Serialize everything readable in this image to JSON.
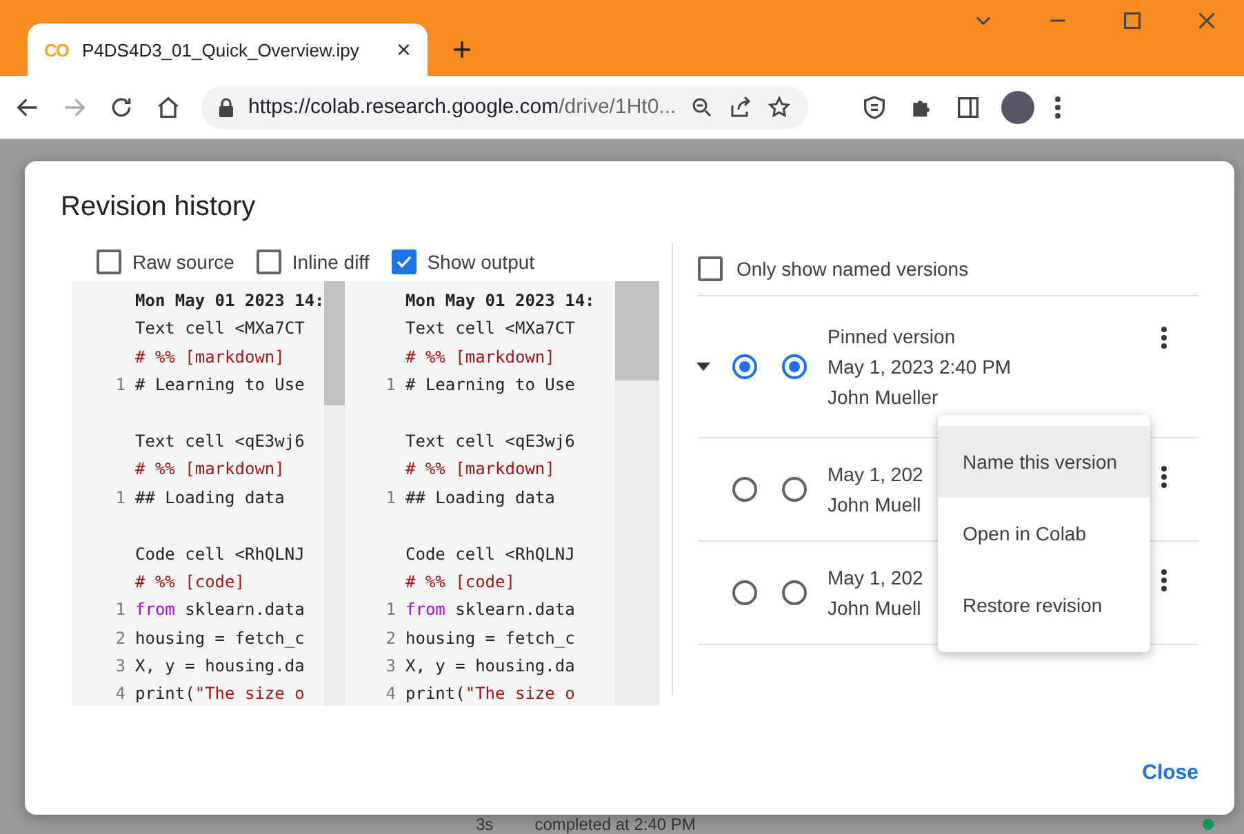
{
  "browser": {
    "tab": {
      "title": "P4DS4D3_01_Quick_Overview.ipy",
      "logo": "CO",
      "close": "×"
    },
    "new_tab": "+",
    "url": {
      "host": "https://colab.research.google.com",
      "path": "/drive/1Ht0..."
    }
  },
  "dialog": {
    "title": "Revision history",
    "options": [
      {
        "label": "Raw source",
        "checked": false
      },
      {
        "label": "Inline diff",
        "checked": false
      },
      {
        "label": "Show output",
        "checked": true
      }
    ],
    "panes": [
      {
        "lines": [
          {
            "kind": "header",
            "text": "Mon May 01 2023 14:"
          },
          {
            "kind": "plain",
            "text": "Text cell <MXa7CT"
          },
          {
            "kind": "marker",
            "text": "# %% [markdown]"
          },
          {
            "num": "1",
            "kind": "plain",
            "text": "# Learning to Use"
          },
          {
            "kind": "blank"
          },
          {
            "kind": "plain",
            "text": "Text cell <qE3wj6"
          },
          {
            "kind": "marker",
            "text": "# %% [markdown]"
          },
          {
            "num": "1",
            "kind": "plain",
            "text": "## Loading data"
          },
          {
            "kind": "blank"
          },
          {
            "kind": "plain",
            "text": "Code cell <RhQLNJ"
          },
          {
            "kind": "marker",
            "text": "# %% [code]"
          },
          {
            "num": "1",
            "kind": "keyword",
            "keyword": "from",
            "text": " sklearn.data"
          },
          {
            "num": "2",
            "kind": "plain",
            "text": "housing = fetch_c"
          },
          {
            "num": "3",
            "kind": "plain",
            "text": "X, y = housing.da"
          },
          {
            "num": "4",
            "kind": "string",
            "keyword": "print(",
            "text": "\"The size o"
          }
        ]
      },
      {
        "lines": [
          {
            "kind": "header",
            "text": "Mon May 01 2023 14:"
          },
          {
            "kind": "plain",
            "text": "Text cell <MXa7CT"
          },
          {
            "kind": "marker",
            "text": "# %% [markdown]"
          },
          {
            "num": "1",
            "kind": "plain",
            "text": "# Learning to Use"
          },
          {
            "kind": "blank"
          },
          {
            "kind": "plain",
            "text": "Text cell <qE3wj6"
          },
          {
            "kind": "marker",
            "text": "# %% [markdown]"
          },
          {
            "num": "1",
            "kind": "plain",
            "text": "## Loading data"
          },
          {
            "kind": "blank"
          },
          {
            "kind": "plain",
            "text": "Code cell <RhQLNJ"
          },
          {
            "kind": "marker",
            "text": "# %% [code]"
          },
          {
            "num": "1",
            "kind": "keyword",
            "keyword": "from",
            "text": " sklearn.data"
          },
          {
            "num": "2",
            "kind": "plain",
            "text": "housing = fetch_c"
          },
          {
            "num": "3",
            "kind": "plain",
            "text": "X, y = housing.da"
          },
          {
            "num": "4",
            "kind": "string",
            "keyword": "print(",
            "text": "\"The size o"
          }
        ]
      }
    ],
    "named_only": {
      "label": "Only show named versions",
      "checked": false
    },
    "versions": [
      {
        "label": "Pinned version",
        "date": "May 1, 2023 2:40 PM",
        "author": "John Mueller",
        "expanded": true,
        "radios": [
          {
            "selected": true
          },
          {
            "selected": true
          }
        ]
      },
      {
        "date": "May 1, 202",
        "author": "John Muell",
        "expanded": false,
        "radios": [
          {
            "selected": false
          },
          {
            "selected": false
          }
        ]
      },
      {
        "date": "May 1, 202",
        "author": "John Muell",
        "expanded": false,
        "radios": [
          {
            "selected": false
          },
          {
            "selected": false
          }
        ]
      }
    ],
    "menu": [
      {
        "label": "Name this version",
        "selected": true
      },
      {
        "label": "Open in Colab",
        "selected": false
      },
      {
        "label": "Restore revision",
        "selected": false
      }
    ],
    "close": "Close"
  },
  "status_bar": {
    "duration": "3s",
    "message": "completed at 2:40 PM"
  }
}
